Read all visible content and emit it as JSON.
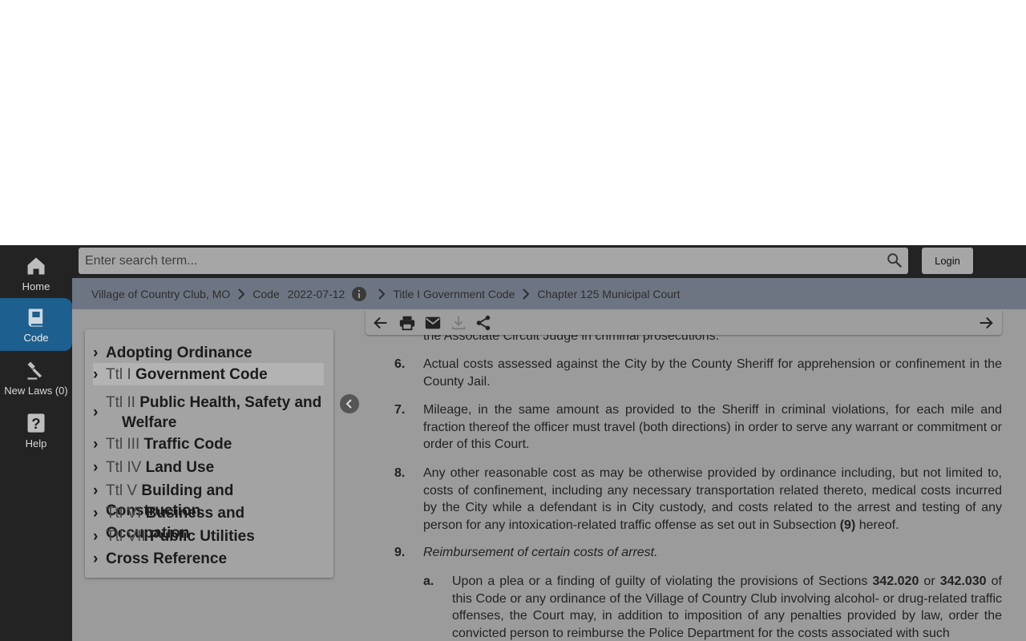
{
  "nav": {
    "home": "Home",
    "code": "Code",
    "new_laws": "New Laws (0)",
    "help": "Help"
  },
  "search": {
    "placeholder": "Enter search term..."
  },
  "login_label": "Login",
  "breadcrumb": {
    "municipality": "Village of Country Club, MO",
    "code": "Code",
    "date": "2022-07-12",
    "title": "Title I Government Code",
    "chapter": "Chapter 125 Municipal Court"
  },
  "toc": [
    {
      "prefix": "",
      "title": "Adopting Ordinance"
    },
    {
      "prefix": "Ttl I",
      "title": "Government Code"
    },
    {
      "prefix": "Ttl II",
      "title": "Public Health, Safety and",
      "title2": "Welfare"
    },
    {
      "prefix": "Ttl III",
      "title": "Traffic Code"
    },
    {
      "prefix": "Ttl IV",
      "title": "Land Use"
    },
    {
      "prefix": "Ttl V",
      "title": "Building and Construction"
    },
    {
      "prefix": "Ttl VI",
      "title": "Business and Occupation"
    },
    {
      "prefix": "Ttl VII",
      "title": "Public Utilities"
    },
    {
      "prefix": "",
      "title": "Cross Reference"
    }
  ],
  "content": {
    "partial_top": "the Associate Circuit Judge in criminal prosecutions.",
    "items": [
      {
        "num": "6.",
        "text": "Actual costs assessed against the City by the County Sheriff for apprehension or confinement in the County Jail."
      },
      {
        "num": "7.",
        "text": "Mileage, in the same amount as provided to the Sheriff in criminal violations, for each mile and fraction thereof the officer must travel (both directions) in order to serve any warrant or commitment or order of this Court."
      },
      {
        "num": "8.",
        "text_before": "Any other reasonable cost as may be otherwise provided by ordinance including, but not limited to, costs of confinement, including any necessary transportation related thereto, medical costs incurred by the City while a defendant is in City custody, and costs related to the arrest and testing of any person for any intoxication-related traffic offense as set out in Subsection ",
        "ref": "(9)",
        "text_after": " hereof."
      },
      {
        "num": "9.",
        "text": "Reimbursement of certain costs of arrest."
      }
    ],
    "sub_a": {
      "num": "a.",
      "text1": "Upon a plea or a finding of guilty of violating the provisions of Sections ",
      "ref1": "342.020",
      "or": " or ",
      "ref2": "342.030",
      "text2": " of this Code or any ordinance of the Village of Country Club involving alcohol- or drug-related traffic offenses, the Court may, in addition to imposition of any penalties provided by law, order the convicted person to reimburse the Police Department for the costs associated with such"
    }
  }
}
